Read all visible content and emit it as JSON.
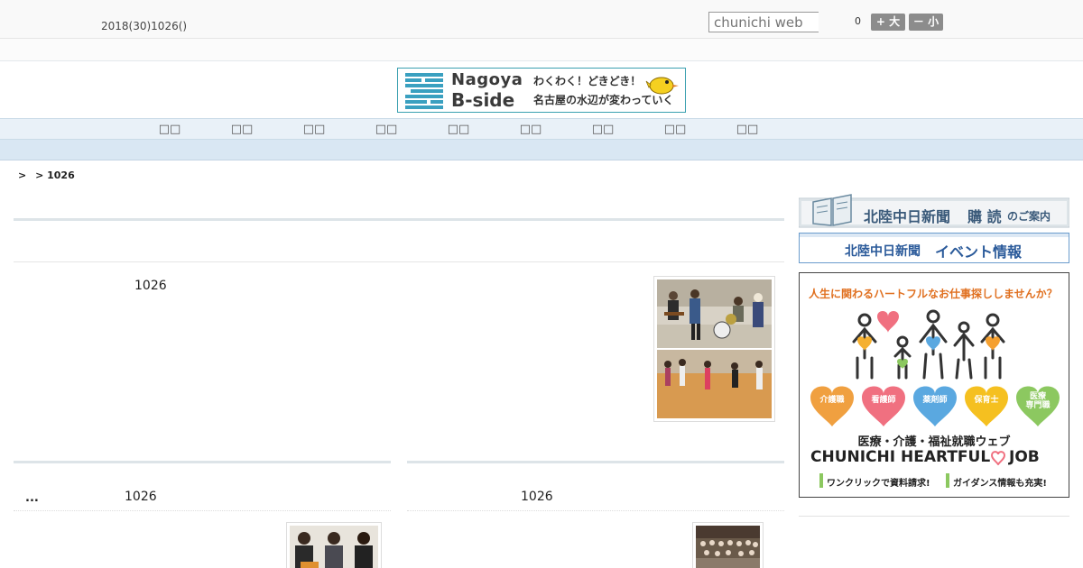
{
  "header": {
    "date": "2018(30)1026()",
    "search_placeholder": "chunichi web",
    "font_size_value": "0",
    "font_larger_label": "+ 大",
    "font_smaller_label": "－ 小"
  },
  "banner": {
    "line1": "Nagoya",
    "line2": "B-side",
    "line3": "わくわく！どきどき！",
    "line4": "名古屋の水辺が変わっていく",
    "stripe_color": "#3aa0c0",
    "bird_color": "#f5d020"
  },
  "nav": {
    "items": [
      "□□",
      "□□",
      "□□",
      "□□",
      "□□",
      "□□",
      "□□",
      "□□",
      "□□"
    ]
  },
  "breadcrumb": {
    "items": [
      ">",
      "> 1026"
    ]
  },
  "main": {
    "top_story": {
      "date": "1026"
    },
    "story_left": {
      "prefix": "...",
      "date": "1026"
    },
    "story_right": {
      "date": "1026"
    }
  },
  "sidebar": {
    "subscribe": {
      "title": "北陸中日新聞",
      "suffix_big": "購 読",
      "suffix_small": "のご案内"
    },
    "event": {
      "title": "北陸中日新聞",
      "suffix": "イベント情報"
    },
    "ad": {
      "headline": "人生に関わるハートフルなお仕事探ししませんか？",
      "hearts": [
        "介護職",
        "看護師",
        "薬剤師",
        "保育士",
        "医療\n専門職"
      ],
      "heart_colors": [
        "#f0a040",
        "#f07080",
        "#5aa8e0",
        "#f5c020",
        "#8cc860"
      ],
      "subtitle": "医療・介護・福祉就職ウェブ",
      "brand": "CHUNICHI HEARTFUL",
      "brand_job": "JOB",
      "note1": "ワンクリックで資料請求!",
      "note2": "ガイダンス情報も充実!"
    }
  }
}
